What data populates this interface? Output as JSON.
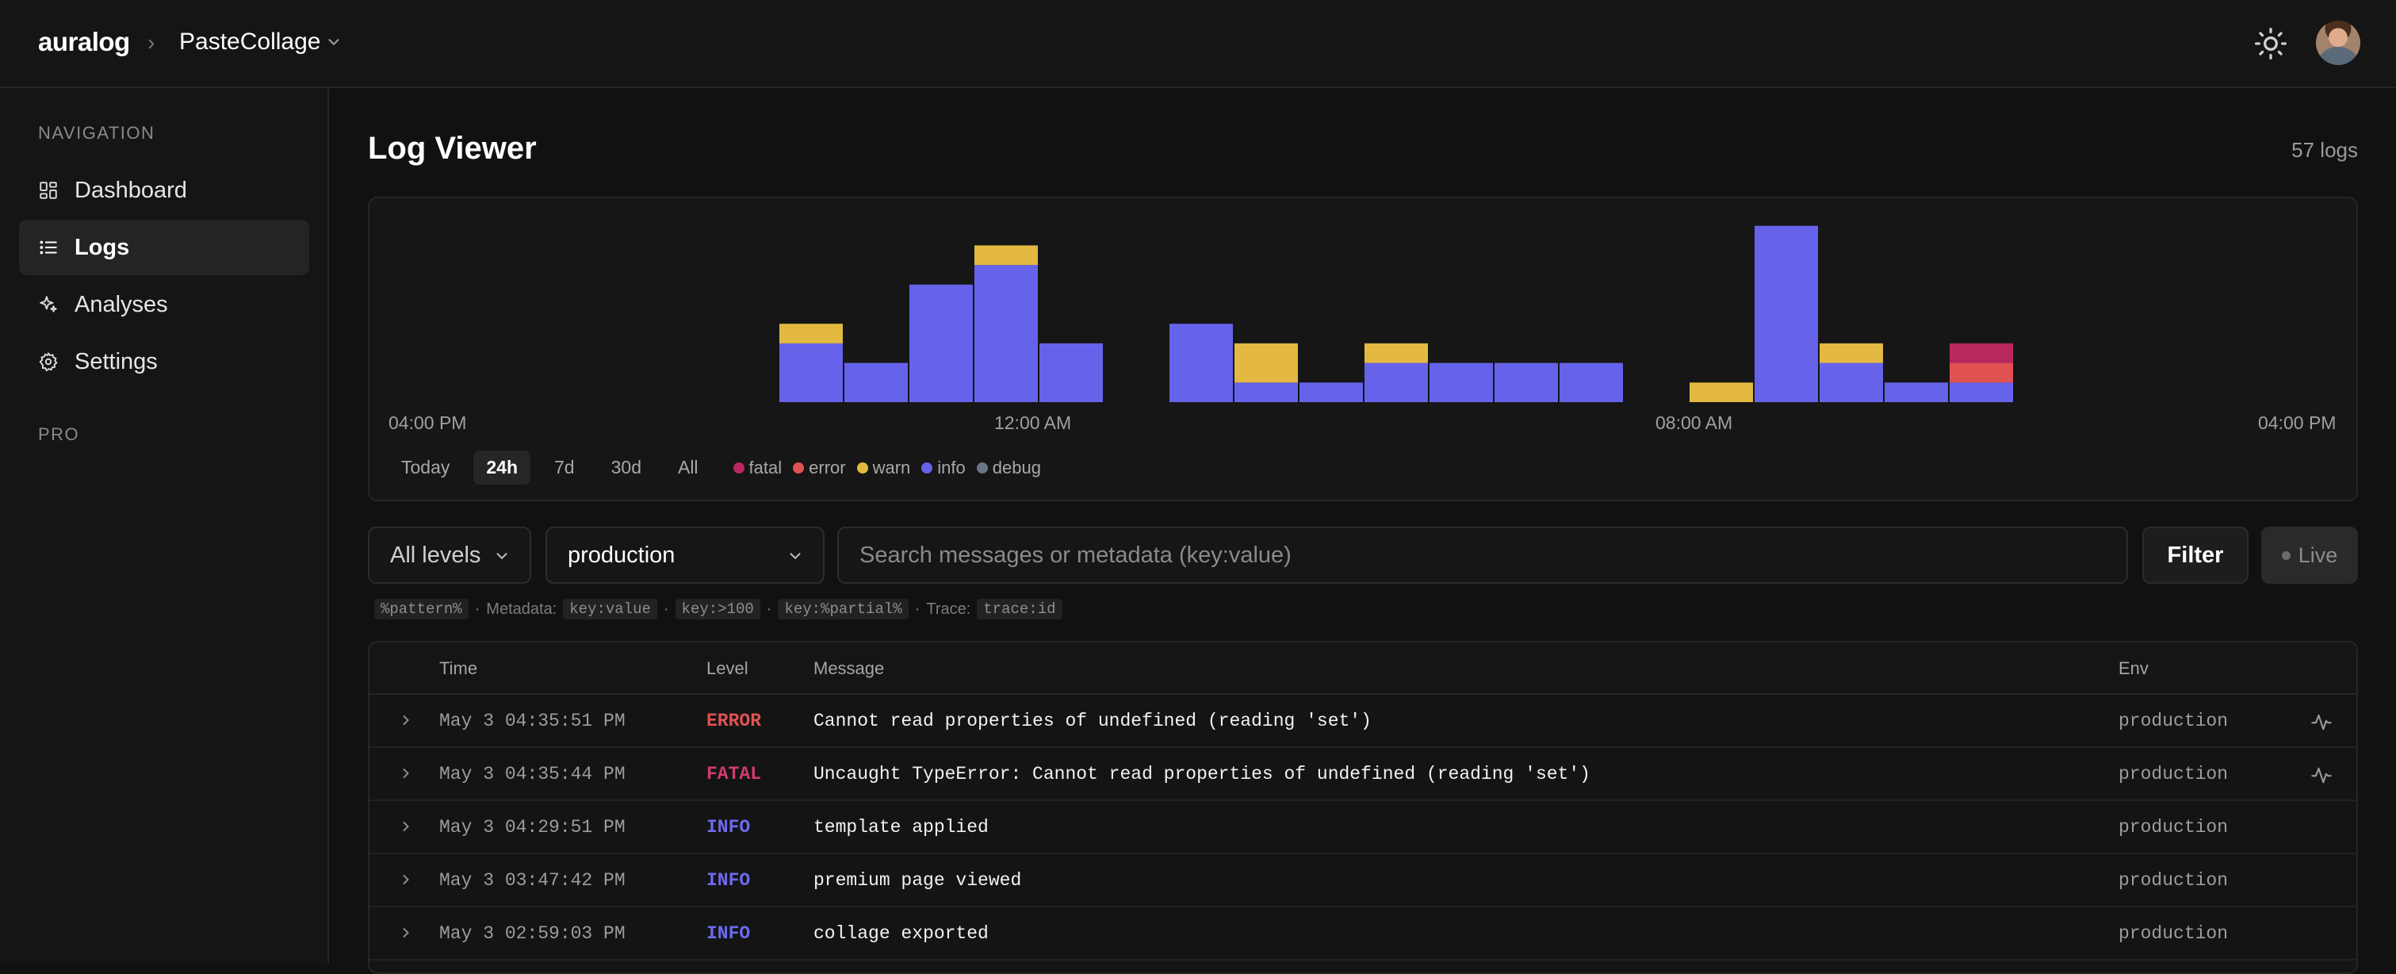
{
  "header": {
    "brand": "auralog",
    "project": "PasteCollage"
  },
  "sidebar": {
    "section_nav": "NAVIGATION",
    "items": [
      {
        "label": "Dashboard",
        "icon": "grid-icon",
        "active": false
      },
      {
        "label": "Logs",
        "icon": "list-icon",
        "active": true
      },
      {
        "label": "Analyses",
        "icon": "sparkle-icon",
        "active": false
      },
      {
        "label": "Settings",
        "icon": "gear-icon",
        "active": false
      }
    ],
    "section_pro": "PRO"
  },
  "page": {
    "title": "Log Viewer",
    "count": "57 logs"
  },
  "chart_data": {
    "type": "bar",
    "stacked": true,
    "x_ticks": [
      "04:00 PM",
      "12:00 AM",
      "08:00 AM",
      "04:00 PM"
    ],
    "buckets": 30,
    "series": [
      {
        "name": "info",
        "color": "#6663ea",
        "values": [
          0,
          0,
          0,
          0,
          0,
          0,
          3,
          2,
          6,
          7,
          3,
          0,
          4,
          1,
          1,
          2,
          2,
          2,
          2,
          0,
          0,
          9,
          2,
          1,
          1,
          0,
          0,
          0,
          0,
          0
        ]
      },
      {
        "name": "warn",
        "color": "#e3b941",
        "values": [
          0,
          0,
          0,
          0,
          0,
          0,
          1,
          0,
          0,
          1,
          0,
          0,
          0,
          2,
          0,
          1,
          0,
          0,
          0,
          0,
          1,
          0,
          1,
          0,
          0,
          0,
          0,
          0,
          0,
          0
        ]
      },
      {
        "name": "error",
        "color": "#e05252",
        "values": [
          0,
          0,
          0,
          0,
          0,
          0,
          0,
          0,
          0,
          0,
          0,
          0,
          0,
          0,
          0,
          0,
          0,
          0,
          0,
          0,
          0,
          0,
          0,
          0,
          1,
          0,
          0,
          0,
          0,
          0
        ]
      },
      {
        "name": "fatal",
        "color": "#b8285e",
        "values": [
          0,
          0,
          0,
          0,
          0,
          0,
          0,
          0,
          0,
          0,
          0,
          0,
          0,
          0,
          0,
          0,
          0,
          0,
          0,
          0,
          0,
          0,
          0,
          0,
          1,
          0,
          0,
          0,
          0,
          0
        ]
      }
    ]
  },
  "ranges": [
    {
      "label": "Today",
      "active": false
    },
    {
      "label": "24h",
      "active": true
    },
    {
      "label": "7d",
      "active": false
    },
    {
      "label": "30d",
      "active": false
    },
    {
      "label": "All",
      "active": false
    }
  ],
  "legend": [
    {
      "label": "fatal",
      "color": "#b8285e"
    },
    {
      "label": "error",
      "color": "#e05252"
    },
    {
      "label": "warn",
      "color": "#e3b941"
    },
    {
      "label": "info",
      "color": "#6663ea"
    },
    {
      "label": "debug",
      "color": "#6b7585"
    }
  ],
  "filters": {
    "level": "All levels",
    "env": "production",
    "search_placeholder": "Search messages or metadata (key:value)",
    "filter_label": "Filter",
    "live_label": "Live"
  },
  "hints": {
    "pattern": "%pattern%",
    "metadata_label": "Metadata:",
    "kv": "key:value",
    "gt": "key:>100",
    "partial": "key:%partial%",
    "trace_label": "Trace:",
    "trace": "trace:id",
    "sep": "·"
  },
  "table": {
    "headers": {
      "time": "Time",
      "level": "Level",
      "message": "Message",
      "env": "Env"
    },
    "rows": [
      {
        "time": "May 3 04:35:51 PM",
        "level": "ERROR",
        "level_color": "#e05252",
        "message": "Cannot read properties of undefined (reading 'set')",
        "env": "production",
        "trace": true
      },
      {
        "time": "May 3 04:35:44 PM",
        "level": "FATAL",
        "level_color": "#d23b6d",
        "message": "Uncaught TypeError: Cannot read properties of undefined (reading 'set')",
        "env": "production",
        "trace": true
      },
      {
        "time": "May 3 04:29:51 PM",
        "level": "INFO",
        "level_color": "#6d6af0",
        "message": "template applied",
        "env": "production",
        "trace": false
      },
      {
        "time": "May 3 03:47:42 PM",
        "level": "INFO",
        "level_color": "#6d6af0",
        "message": "premium page viewed",
        "env": "production",
        "trace": false
      },
      {
        "time": "May 3 02:59:03 PM",
        "level": "INFO",
        "level_color": "#6d6af0",
        "message": "collage exported",
        "env": "production",
        "trace": false
      }
    ]
  }
}
